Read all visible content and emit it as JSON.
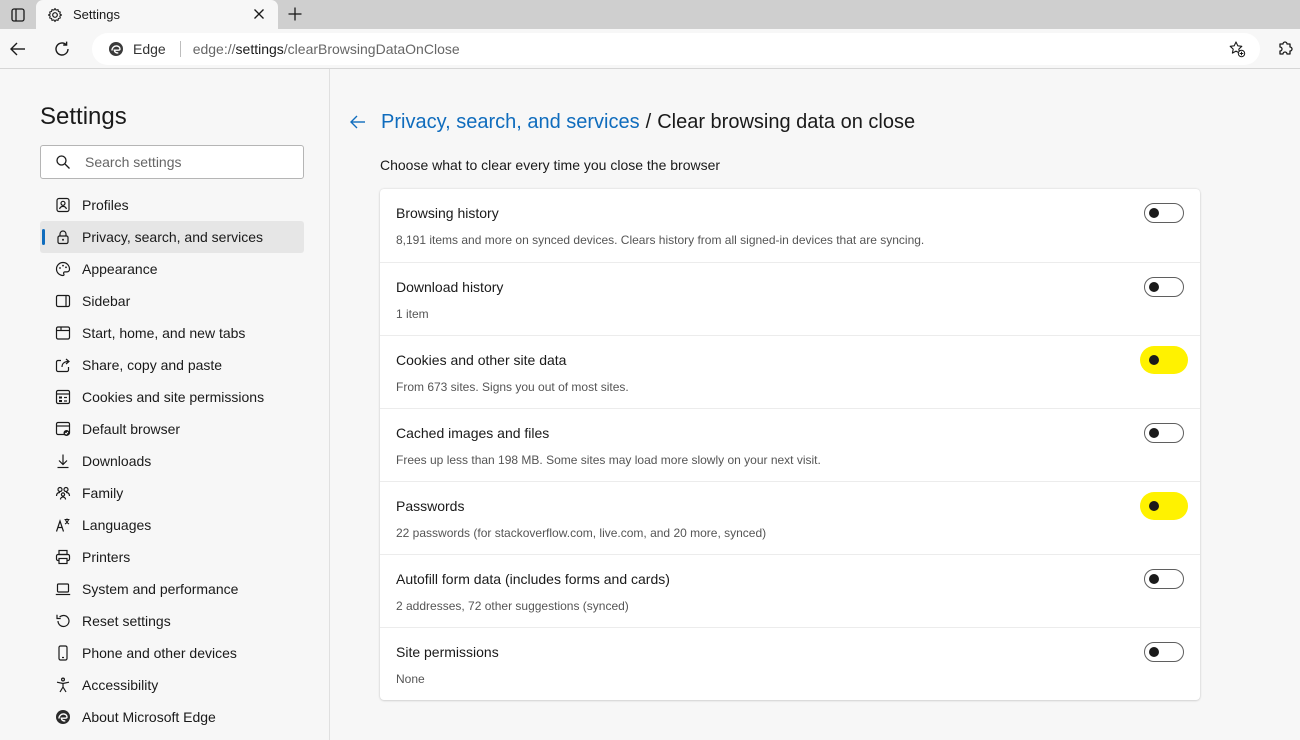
{
  "tab": {
    "title": "Settings"
  },
  "toolbar": {
    "identity": "Edge",
    "url_prefix": "edge://",
    "url_host": "settings",
    "url_path": "/clearBrowsingDataOnClose"
  },
  "sidebar": {
    "title": "Settings",
    "search_placeholder": "Search settings",
    "items": [
      {
        "label": "Profiles",
        "icon": "profile-icon"
      },
      {
        "label": "Privacy, search, and services",
        "icon": "lock-icon",
        "active": true
      },
      {
        "label": "Appearance",
        "icon": "palette-icon"
      },
      {
        "label": "Sidebar",
        "icon": "sidebar-icon"
      },
      {
        "label": "Start, home, and new tabs",
        "icon": "home-tabs-icon"
      },
      {
        "label": "Share, copy and paste",
        "icon": "share-icon"
      },
      {
        "label": "Cookies and site permissions",
        "icon": "site-permissions-icon"
      },
      {
        "label": "Default browser",
        "icon": "default-browser-icon"
      },
      {
        "label": "Downloads",
        "icon": "download-icon"
      },
      {
        "label": "Family",
        "icon": "family-icon"
      },
      {
        "label": "Languages",
        "icon": "languages-icon"
      },
      {
        "label": "Printers",
        "icon": "printer-icon"
      },
      {
        "label": "System and performance",
        "icon": "laptop-icon"
      },
      {
        "label": "Reset settings",
        "icon": "reset-icon"
      },
      {
        "label": "Phone and other devices",
        "icon": "phone-icon"
      },
      {
        "label": "Accessibility",
        "icon": "accessibility-icon"
      },
      {
        "label": "About Microsoft Edge",
        "icon": "edge-logo-icon"
      }
    ]
  },
  "main": {
    "breadcrumb_parent": "Privacy, search, and services",
    "breadcrumb_separator": "/",
    "breadcrumb_current": "Clear browsing data on close",
    "intro": "Choose what to clear every time you close the browser",
    "highlight_color": "#fff200",
    "rows": [
      {
        "title": "Browsing history",
        "desc": "8,191 items and more on synced devices. Clears history from all signed-in devices that are syncing.",
        "on": false,
        "highlighted": false
      },
      {
        "title": "Download history",
        "desc": "1 item",
        "on": false,
        "highlighted": false
      },
      {
        "title": "Cookies and other site data",
        "desc": "From 673 sites. Signs you out of most sites.",
        "on": false,
        "highlighted": true
      },
      {
        "title": "Cached images and files",
        "desc": "Frees up less than 198 MB. Some sites may load more slowly on your next visit.",
        "on": false,
        "highlighted": false
      },
      {
        "title": "Passwords",
        "desc": "22 passwords (for stackoverflow.com, live.com, and 20 more, synced)",
        "on": false,
        "highlighted": true
      },
      {
        "title": "Autofill form data (includes forms and cards)",
        "desc": "2 addresses, 72 other suggestions (synced)",
        "on": false,
        "highlighted": false
      },
      {
        "title": "Site permissions",
        "desc": "None",
        "on": false,
        "highlighted": false
      }
    ]
  }
}
